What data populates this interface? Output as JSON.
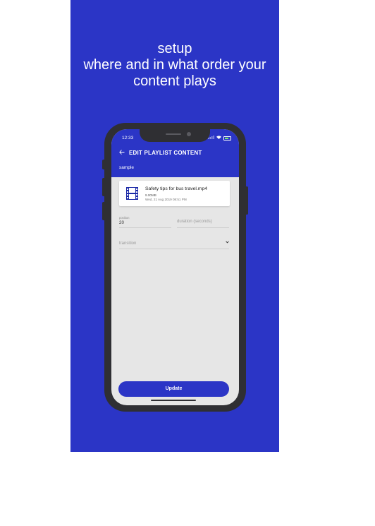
{
  "promo": {
    "background": "#2b35c6",
    "headline_lines": [
      "setup",
      "where and in what order your",
      "content plays"
    ]
  },
  "phone": {
    "status_bar": {
      "time": "12:33"
    },
    "header": {
      "back_icon": "arrow-left-icon",
      "title": "EDIT PLAYLIST CONTENT",
      "playlist_name": "sample"
    },
    "file_card": {
      "icon": "film-icon",
      "name": "Safety tips for bus travel.mp4",
      "size": "9.00MB",
      "date": "Wed, 21 Aug 2019 08:51 PM"
    },
    "form": {
      "position": {
        "label": "position",
        "value": "20"
      },
      "duration": {
        "placeholder": "duration (seconds)"
      },
      "transition": {
        "placeholder": "transition",
        "icon": "chevron-down-icon"
      }
    },
    "update_button": {
      "label": "Update"
    }
  }
}
